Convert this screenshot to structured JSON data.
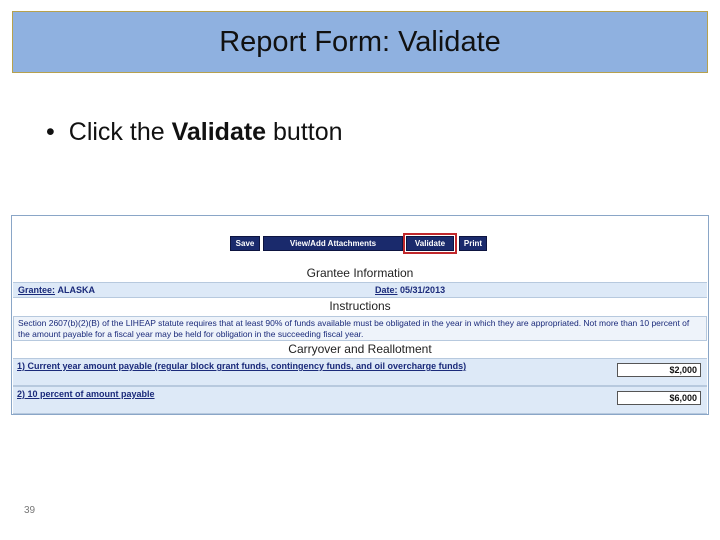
{
  "slide": {
    "title": "Report Form: Validate",
    "bullet_prefix": "Click the ",
    "bullet_bold": "Validate",
    "bullet_suffix": " button",
    "page_number": "39"
  },
  "form": {
    "toolbar": {
      "save_label": "Save",
      "attachments_label": "View/Add Attachments",
      "validate_label": "Validate",
      "print_label": "Print"
    },
    "grantee_section_title": "Grantee Information",
    "grantee_label": "Grantee:",
    "grantee_value": "ALASKA",
    "date_label": "Date:",
    "date_value": "05/31/2013",
    "instructions_title": "Instructions",
    "instructions_text": "Section 2607(b)(2)(B) of the LIHEAP statute requires that at least 90% of funds available must be obligated in the year in which they are appropriated. Not more than 10 percent of the amount payable for a fiscal year may be held for obligation in the succeeding fiscal year.",
    "carryover_title": "Carryover and Reallotment",
    "line1_label": "1) Current year amount payable (regular block grant funds, contingency funds, and oil overcharge funds)",
    "line1_value": "$2,000",
    "line2_label": "2) 10 percent of amount payable",
    "line2_value": "$6,000"
  },
  "colors": {
    "title_bar": "#8fb1e0",
    "button_bg": "#1a2a6c",
    "highlight": "#c0282c"
  }
}
